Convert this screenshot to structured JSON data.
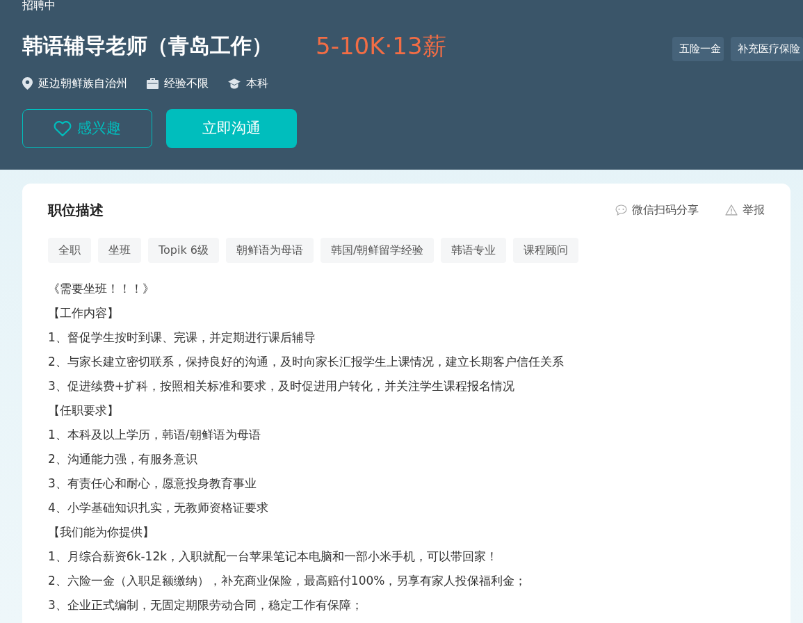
{
  "job": {
    "status": "招聘中",
    "title": "韩语辅导老师（青岛工作）",
    "salary": "5-10K·13薪",
    "benefits": [
      "五险一金",
      "补充医疗保险"
    ],
    "meta": [
      {
        "kind": "location",
        "text": "延边朝鲜族自治州"
      },
      {
        "kind": "experience",
        "text": "经验不限"
      },
      {
        "kind": "degree",
        "text": "本科"
      }
    ],
    "buttons": [
      {
        "kind": "interest",
        "label": "感兴趣"
      },
      {
        "kind": "chat",
        "label": "立即沟通"
      }
    ]
  },
  "description": {
    "title": "职位描述",
    "actions": [
      {
        "kind": "share",
        "label": "微信扫码分享"
      },
      {
        "kind": "report",
        "label": "举报"
      }
    ],
    "tags": [
      "全职",
      "坐班",
      "Topik 6级",
      "朝鲜语为母语",
      "韩国/朝鲜留学经验",
      "韩语专业",
      "课程顾问"
    ],
    "lines": [
      "《需要坐班！！！》",
      "【工作内容】",
      "1、督促学生按时到课、完课，并定期进行课后辅导",
      "2、与家长建立密切联系，保持良好的沟通，及时向家长汇报学生上课情况，建立长期客户信任关系",
      "3、促进续费+扩科，按照相关标准和要求，及时促进用户转化，并关注学生课程报名情况",
      "【任职要求】",
      "1、本科及以上学历，韩语/朝鲜语为母语",
      "2、沟通能力强，有服务意识",
      "3、有责任心和耐心，愿意投身教育事业",
      "4、小学基础知识扎实，无教师资格证要求",
      "【我们能为你提供】",
      "1、月综合薪资6k-12k，入职就配一台苹果笔记本电脑和一部小米手机，可以带回家！",
      "2、六险一金（入职足额缴纳），补充商业保险，最高赔付100%，另享有家人投保福利金；",
      "3、企业正式编制，无固定期限劳动合同，稳定工作有保障；"
    ]
  }
}
